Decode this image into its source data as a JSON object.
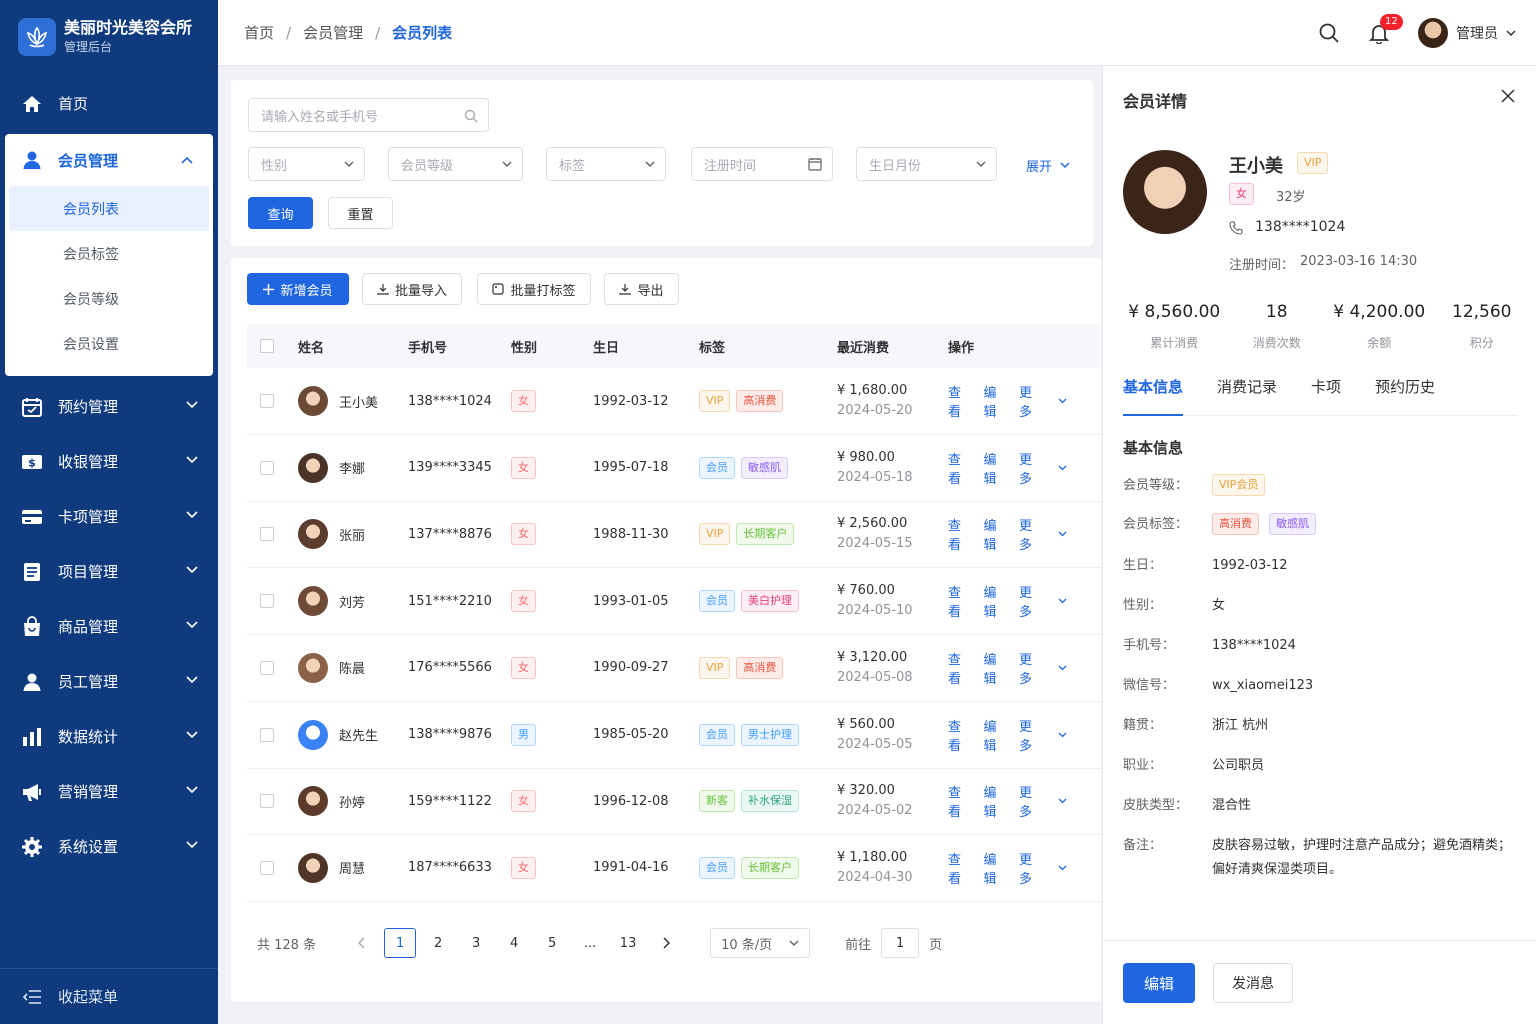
{
  "brand": {
    "title": "美丽时光美容会所",
    "subtitle": "管理后台"
  },
  "sidebar": {
    "home": "首页",
    "member": {
      "label": "会员管理",
      "subs": [
        "会员列表",
        "会员标签",
        "会员等级",
        "会员设置"
      ]
    },
    "items": [
      "预约管理",
      "收银管理",
      "卡项管理",
      "项目管理",
      "商品管理",
      "员工管理",
      "数据统计",
      "营销管理",
      "系统设置"
    ],
    "collapse": "收起菜单"
  },
  "topbar": {
    "crumbs": [
      "首页",
      "会员管理",
      "会员列表"
    ],
    "notify_count": "12",
    "user": "管理员"
  },
  "filter": {
    "search_placeholder": "请输入姓名或手机号",
    "gender": "性别",
    "level": "会员等级",
    "tag": "标签",
    "reg_time": "注册时间",
    "birth_month": "生日月份",
    "expand": "展开",
    "query": "查询",
    "reset": "重置"
  },
  "toolbar": {
    "add": "新增会员",
    "import": "批量导入",
    "batch_tag": "批量打标签",
    "export": "导出"
  },
  "table": {
    "headers": [
      "姓名",
      "手机号",
      "性别",
      "生日",
      "标签",
      "最近消费",
      "操作"
    ],
    "ops": [
      "查看",
      "编辑",
      "更多"
    ],
    "rows": [
      {
        "name": "王小美",
        "phone": "138****1024",
        "gender": "女",
        "birthday": "1992-03-12",
        "tags": [
          {
            "text": "VIP",
            "style": "t-orange"
          },
          {
            "text": "高消费",
            "style": "t-orred"
          }
        ],
        "amount": "¥ 1,680.00",
        "date": "2024-05-20",
        "avatar": "#6b4a36"
      },
      {
        "name": "李娜",
        "phone": "139****3345",
        "gender": "女",
        "birthday": "1995-07-18",
        "tags": [
          {
            "text": "会员",
            "style": "t-blue"
          },
          {
            "text": "敏感肌",
            "style": "t-purple"
          }
        ],
        "amount": "¥ 980.00",
        "date": "2024-05-18",
        "avatar": "#4a3328"
      },
      {
        "name": "张丽",
        "phone": "137****8876",
        "gender": "女",
        "birthday": "1988-11-30",
        "tags": [
          {
            "text": "VIP",
            "style": "t-orange"
          },
          {
            "text": "长期客户",
            "style": "t-green"
          }
        ],
        "amount": "¥ 2,560.00",
        "date": "2024-05-15",
        "avatar": "#5a3d2c"
      },
      {
        "name": "刘芳",
        "phone": "151****2210",
        "gender": "女",
        "birthday": "1993-01-05",
        "tags": [
          {
            "text": "会员",
            "style": "t-blue"
          },
          {
            "text": "美白护理",
            "style": "t-pink"
          }
        ],
        "amount": "¥ 760.00",
        "date": "2024-05-10",
        "avatar": "#6e4a38"
      },
      {
        "name": "陈晨",
        "phone": "176****5566",
        "gender": "女",
        "birthday": "1990-09-27",
        "tags": [
          {
            "text": "VIP",
            "style": "t-orange"
          },
          {
            "text": "高消费",
            "style": "t-orred"
          }
        ],
        "amount": "¥ 3,120.00",
        "date": "2024-05-08",
        "avatar": "#8a6248"
      },
      {
        "name": "赵先生",
        "phone": "138****9876",
        "gender": "男",
        "birthday": "1985-05-20",
        "tags": [
          {
            "text": "会员",
            "style": "t-blue"
          },
          {
            "text": "男士护理",
            "style": "t-blue"
          }
        ],
        "amount": "¥ 560.00",
        "date": "2024-05-05",
        "avatar": "#3b82f6"
      },
      {
        "name": "孙婷",
        "phone": "159****1122",
        "gender": "女",
        "birthday": "1996-12-08",
        "tags": [
          {
            "text": "新客",
            "style": "t-green"
          },
          {
            "text": "补水保湿",
            "style": "t-teal"
          }
        ],
        "amount": "¥ 320.00",
        "date": "2024-05-02",
        "avatar": "#5c3b2b"
      },
      {
        "name": "周慧",
        "phone": "187****6633",
        "gender": "女",
        "birthday": "1991-04-16",
        "tags": [
          {
            "text": "会员",
            "style": "t-blue"
          },
          {
            "text": "长期客户",
            "style": "t-green"
          }
        ],
        "amount": "¥ 1,180.00",
        "date": "2024-04-30",
        "avatar": "#4f3527"
      }
    ]
  },
  "pagination": {
    "total": "共 128 条",
    "pages": [
      "1",
      "2",
      "3",
      "4",
      "5",
      "...",
      "13"
    ],
    "page_size": "10 条/页",
    "goto": "前往",
    "goto_value": "1",
    "page_unit": "页"
  },
  "detail": {
    "title": "会员详情",
    "name": "王小美",
    "vip": "VIP",
    "gender": "女",
    "age": "32岁",
    "phone": "138****1024",
    "reg_label": "注册时间：",
    "reg_time": "2023-03-16 14:30",
    "stats": [
      {
        "value": "¥ 8,560.00",
        "label": "累计消费"
      },
      {
        "value": "18",
        "label": "消费次数"
      },
      {
        "value": "¥ 4,200.00",
        "label": "余额"
      },
      {
        "value": "12,560",
        "label": "积分"
      }
    ],
    "tabs": [
      "基本信息",
      "消费记录",
      "卡项",
      "预约历史"
    ],
    "section": "基本信息",
    "level_label": "会员等级：",
    "level_value": "VIP会员",
    "tags_label": "会员标签：",
    "tags": [
      "高消费",
      "敏感肌"
    ],
    "fields": [
      {
        "k": "生日：",
        "v": "1992-03-12"
      },
      {
        "k": "性别：",
        "v": "女"
      },
      {
        "k": "手机号：",
        "v": "138****1024"
      },
      {
        "k": "微信号：",
        "v": "wx_xiaomei123"
      },
      {
        "k": "籍贯：",
        "v": "浙江 杭州"
      },
      {
        "k": "职业：",
        "v": "公司职员"
      },
      {
        "k": "皮肤类型：",
        "v": "混合性"
      },
      {
        "k": "备注：",
        "v": "皮肤容易过敏，护理时注意产品成分；避免酒精类；偏好清爽保湿类项目。"
      }
    ],
    "edit": "编辑",
    "message": "发消息"
  }
}
